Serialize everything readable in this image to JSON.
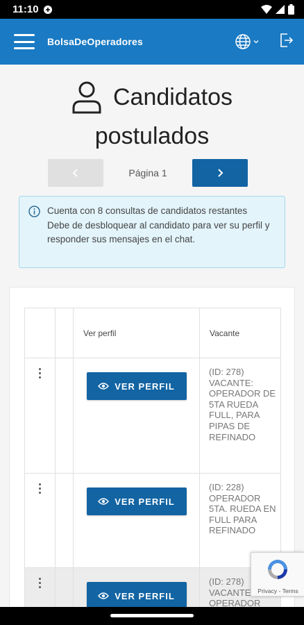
{
  "status_bar": {
    "time": "11:10"
  },
  "app_bar": {
    "brand": "BolsaDeOperadores",
    "icons": [
      "menu-icon",
      "globe-icon",
      "chevron-down-icon",
      "logout-icon"
    ]
  },
  "page": {
    "title_line1": "Candidatos",
    "title_line2": "postulados",
    "title_icon": "person-icon"
  },
  "pager": {
    "label": "Página 1",
    "prev_icon": "chevron-left-icon",
    "next_icon": "chevron-right-icon"
  },
  "info": {
    "line1": "Cuenta con 8 consultas de candidatos restantes",
    "line2": "Debe de desbloquear al candidato para ver su perfil y responder sus mensajes en el chat."
  },
  "table": {
    "headers": [
      "",
      "",
      "Ver perfil",
      "Vacante"
    ],
    "button_label": "VER PERFIL",
    "rows": [
      {
        "vacante": "(ID: 278) VACANTE: OPERADOR DE 5TA RUEDA FULL, PARA PIPAS DE REFINADO"
      },
      {
        "vacante": "(ID: 228) OPERADOR 5TA. RUEDA EN FULL PARA REFINADO"
      },
      {
        "vacante": "(ID: 278) VACANTE: OPERADOR"
      }
    ]
  },
  "recaptcha": {
    "label": "Privacy - Terms"
  },
  "colors": {
    "primary": "#1a7ac3",
    "button": "#1264a3",
    "info_bg": "#e3f4fb"
  }
}
